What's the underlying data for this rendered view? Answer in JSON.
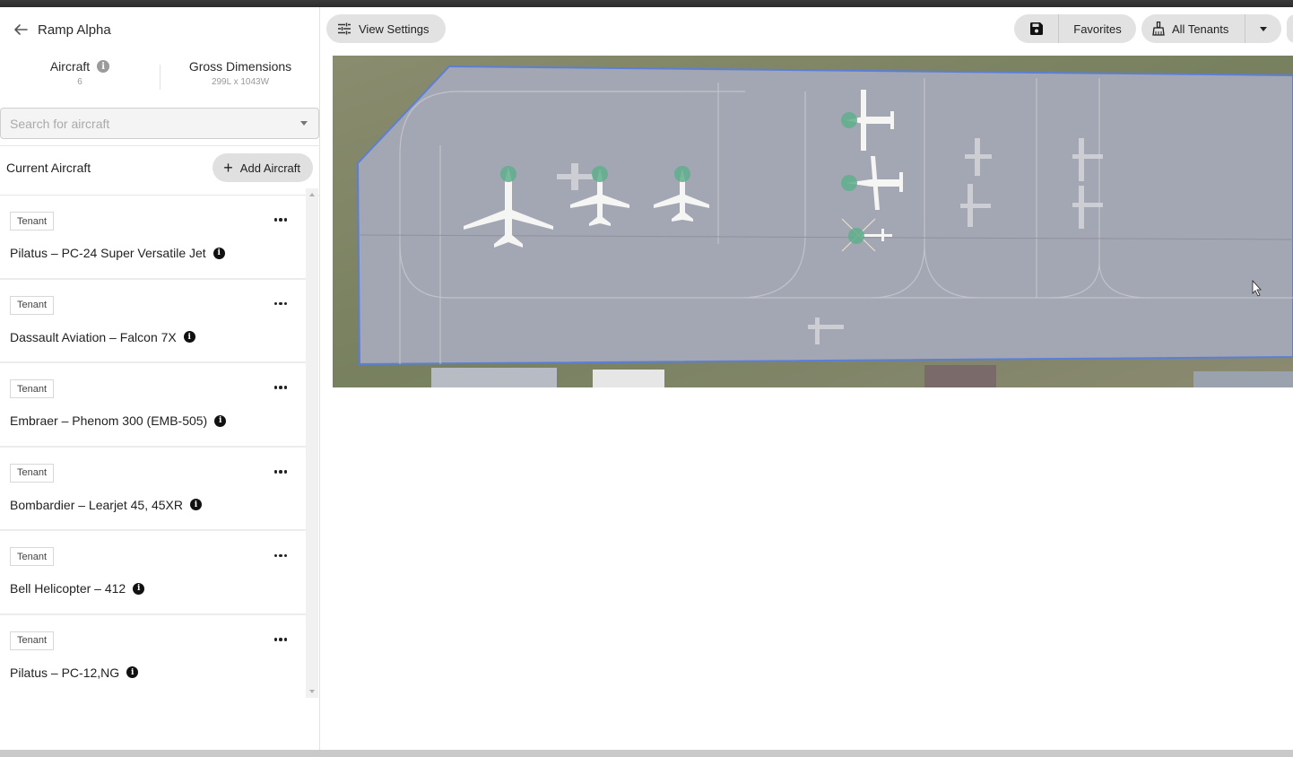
{
  "header": {
    "back_label": "Ramp Alpha",
    "stats": {
      "aircraft_label": "Aircraft",
      "aircraft_count": "6",
      "dimensions_label": "Gross Dimensions",
      "dimensions_value": "299L x 1043W"
    }
  },
  "search": {
    "placeholder": "Search for aircraft",
    "value": ""
  },
  "current": {
    "label": "Current Aircraft",
    "add_button": "Add Aircraft"
  },
  "aircraft": [
    {
      "tag": "Tenant",
      "name": "Pilatus – PC-24 Super Versatile Jet"
    },
    {
      "tag": "Tenant",
      "name": "Dassault Aviation – Falcon 7X"
    },
    {
      "tag": "Tenant",
      "name": "Embraer – Phenom 300 (EMB-505)"
    },
    {
      "tag": "Tenant",
      "name": "Bombardier – Learjet 45, 45XR"
    },
    {
      "tag": "Tenant",
      "name": "Bell Helicopter – 412"
    },
    {
      "tag": "Tenant",
      "name": "Pilatus – PC-12,NG"
    }
  ],
  "toolbar": {
    "view_settings": "View Settings",
    "favorites": "Favorites",
    "tenants": "All Tenants"
  },
  "icons": {
    "back": "arrow-left-icon",
    "info": "info-icon",
    "more": "more-horizontal-icon",
    "sliders": "sliders-icon",
    "save": "floppy-disk-icon",
    "broom": "broom-icon",
    "dropdown": "caret-down-icon"
  },
  "colors": {
    "ramp_outline": "#5b7fd6",
    "aircraft_marker": "#5fae8c",
    "pill_bg": "#e2e2e2"
  }
}
